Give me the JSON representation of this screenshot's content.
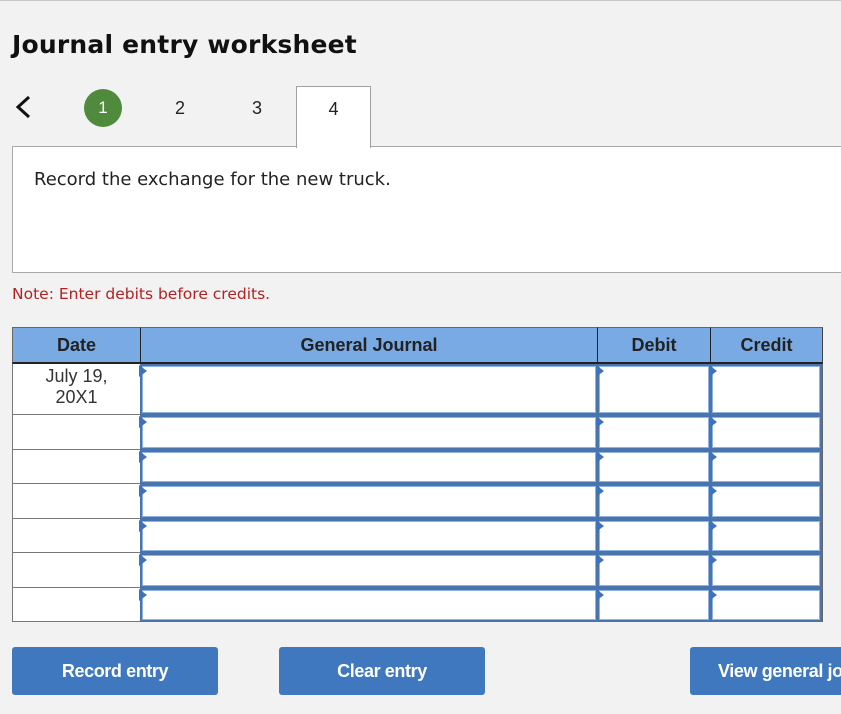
{
  "header": {
    "title": "Journal entry worksheet"
  },
  "nav": {
    "back_icon": "chevron-left-icon",
    "steps": [
      {
        "label": "1",
        "state": "completed"
      },
      {
        "label": "2",
        "state": "default"
      },
      {
        "label": "3",
        "state": "default"
      },
      {
        "label": "4",
        "state": "active"
      }
    ]
  },
  "prompt": {
    "text": "Record the exchange for the new truck."
  },
  "note": {
    "text": "Note: Enter debits before credits."
  },
  "table": {
    "columns": [
      "Date",
      "General Journal",
      "Debit",
      "Credit"
    ],
    "rows": [
      {
        "date": "July 19, 20X1",
        "account": "",
        "debit": "",
        "credit": ""
      },
      {
        "date": "",
        "account": "",
        "debit": "",
        "credit": ""
      },
      {
        "date": "",
        "account": "",
        "debit": "",
        "credit": ""
      },
      {
        "date": "",
        "account": "",
        "debit": "",
        "credit": ""
      },
      {
        "date": "",
        "account": "",
        "debit": "",
        "credit": ""
      },
      {
        "date": "",
        "account": "",
        "debit": "",
        "credit": ""
      },
      {
        "date": "",
        "account": "",
        "debit": "",
        "credit": ""
      }
    ]
  },
  "buttons": {
    "record": "Record entry",
    "clear": "Clear entry",
    "view": "View general journal"
  },
  "colors": {
    "header_bg": "#7aaae3",
    "button_bg": "#3f78bf",
    "completed_step": "#4f8a3d",
    "note_text": "#b22222"
  }
}
